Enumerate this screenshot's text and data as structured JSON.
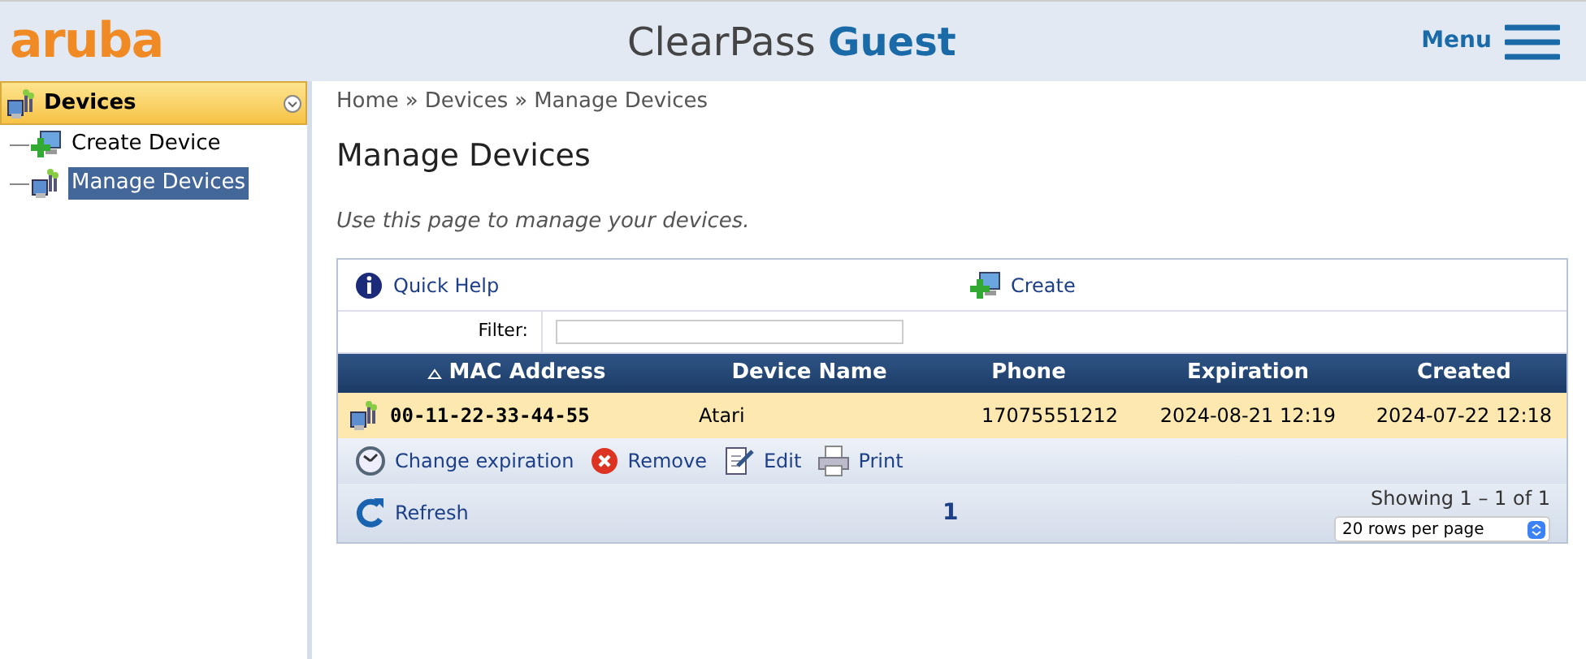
{
  "header": {
    "logo": "aruba",
    "title_main": "ClearPass",
    "title_accent": "Guest",
    "menu_label": "Menu"
  },
  "sidebar": {
    "section": {
      "label": "Devices",
      "expanded": true
    },
    "items": [
      {
        "label": "Create Device",
        "kind": "create",
        "selected": false
      },
      {
        "label": "Manage Devices",
        "kind": "device",
        "selected": true
      }
    ]
  },
  "breadcrumb": [
    "Home",
    "»",
    "Devices",
    "»",
    "Manage Devices"
  ],
  "page_title": "Manage Devices",
  "intro": "Use this page to manage your devices.",
  "toolbar": [
    {
      "label": "Quick Help",
      "kind": "help"
    },
    {
      "label": "Create",
      "kind": "create"
    }
  ],
  "filter": {
    "label": "Filter:"
  },
  "table": {
    "columns": [
      {
        "label": "MAC Address",
        "sorted": true
      },
      {
        "label": "Device Name",
        "sorted": false
      },
      {
        "label": "Phone",
        "sorted": false
      },
      {
        "label": "Expiration",
        "sorted": false
      },
      {
        "label": "Created",
        "sorted": false
      }
    ],
    "rows": [
      {
        "cells": [
          "00-11-22-33-44-55",
          "Atari",
          "17075551212",
          "2024-08-21 12:19",
          "2024-07-22 12:18"
        ],
        "selected": true
      }
    ]
  },
  "row_actions": [
    {
      "label": "Change expiration",
      "kind": "clock"
    },
    {
      "label": "Remove",
      "kind": "remove"
    },
    {
      "label": "Edit",
      "kind": "edit"
    },
    {
      "label": "Print",
      "kind": "print"
    }
  ],
  "footer": {
    "refresh": "Refresh",
    "page": "1",
    "showing": "Showing 1 – 1 of 1",
    "rows_per_page": "20 rows per page"
  }
}
